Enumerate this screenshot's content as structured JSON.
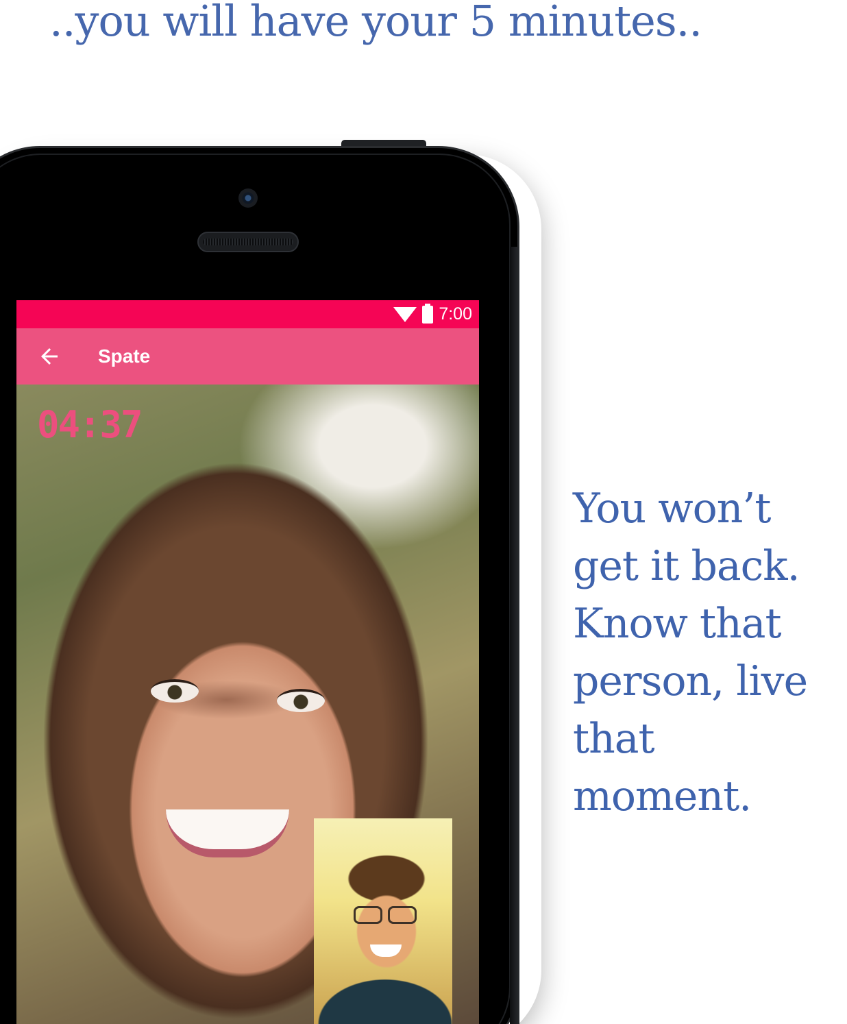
{
  "headline": "..you will have your 5 minutes..",
  "tagline": {
    "lines": [
      "You won’t",
      "get it back.",
      "Know that",
      "person, live",
      "that",
      "moment."
    ]
  },
  "status_bar": {
    "time": "7:00",
    "color": "#f50555"
  },
  "app_bar": {
    "title": "Spate",
    "back_icon": "arrow-back-icon",
    "color": "#ec5280"
  },
  "call": {
    "timer": "04:37",
    "timer_color": "#ec4f7e"
  },
  "colors": {
    "text_blue": "#4667ad"
  }
}
